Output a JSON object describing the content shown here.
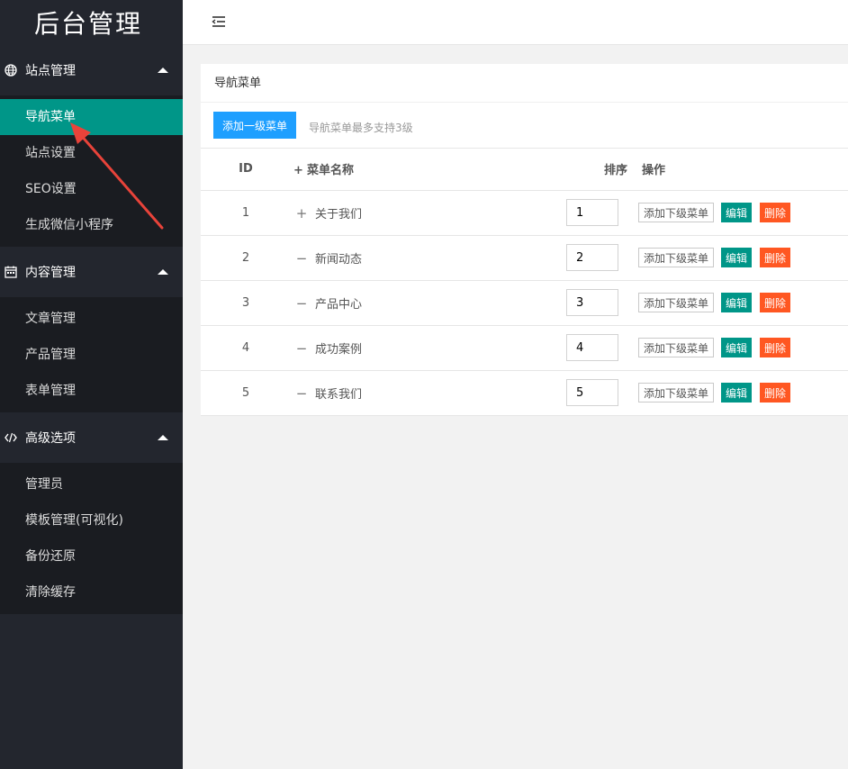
{
  "app": {
    "title": "后台管理"
  },
  "sidebar": {
    "groups": [
      {
        "label": "站点管理",
        "icon": "globe-icon",
        "items": [
          {
            "label": "导航菜单",
            "active": true
          },
          {
            "label": "站点设置"
          },
          {
            "label": "SEO设置"
          },
          {
            "label": "生成微信小程序"
          }
        ]
      },
      {
        "label": "内容管理",
        "icon": "calendar-icon",
        "items": [
          {
            "label": "文章管理"
          },
          {
            "label": "产品管理"
          },
          {
            "label": "表单管理"
          }
        ]
      },
      {
        "label": "高级选项",
        "icon": "code-icon",
        "items": [
          {
            "label": "管理员"
          },
          {
            "label": "模板管理(可视化)"
          },
          {
            "label": "备份还原"
          },
          {
            "label": "清除缓存"
          }
        ]
      }
    ]
  },
  "header": {
    "toggle_icon": "menu-fold-icon"
  },
  "card": {
    "title": "导航菜单",
    "add_button": "添加一级菜单",
    "hint": "导航菜单最多支持3级"
  },
  "table": {
    "headers": {
      "id": "ID",
      "expand": "+",
      "name": "菜单名称",
      "sort": "排序",
      "op": "操作"
    },
    "rows": [
      {
        "id": "1",
        "sym": "+",
        "name": "关于我们",
        "sort": "1"
      },
      {
        "id": "2",
        "sym": "−",
        "name": "新闻动态",
        "sort": "2"
      },
      {
        "id": "3",
        "sym": "−",
        "name": "产品中心",
        "sort": "3"
      },
      {
        "id": "4",
        "sym": "−",
        "name": "成功案例",
        "sort": "4"
      },
      {
        "id": "5",
        "sym": "−",
        "name": "联系我们",
        "sort": "5"
      }
    ],
    "actions": {
      "add_child": "添加下级菜单",
      "edit": "编辑",
      "delete": "删除"
    }
  },
  "colors": {
    "sidebar_bg": "#23262e",
    "active": "#009688",
    "primary": "#1e9fff",
    "danger": "#ff5722",
    "annotation": "#e8433a"
  }
}
